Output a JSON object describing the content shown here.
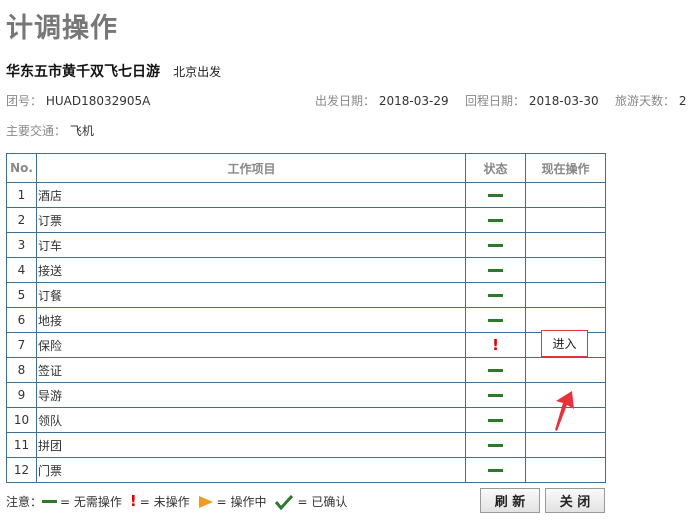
{
  "page": {
    "title": "计调操作"
  },
  "tour": {
    "name": "华东五市黄千双飞七日游",
    "departure_city": "北京出发"
  },
  "info": {
    "group_label": "团号：",
    "group_no": "HUAD18032905A",
    "depart_label": "出发日期：",
    "depart_date": "2018-03-29",
    "return_label": "回程日期：",
    "return_date": "2018-03-30",
    "days_label": "旅游天数：",
    "days": "2"
  },
  "transport": {
    "label": "主要交通：",
    "value": "飞机"
  },
  "table": {
    "headers": {
      "no": "No.",
      "item": "工作项目",
      "status": "状态",
      "op": "现在操作"
    },
    "rows": [
      {
        "no": "1",
        "item": "酒店",
        "status": "none"
      },
      {
        "no": "2",
        "item": "订票",
        "status": "none"
      },
      {
        "no": "3",
        "item": "订车",
        "status": "none"
      },
      {
        "no": "4",
        "item": "接送",
        "status": "none"
      },
      {
        "no": "5",
        "item": "订餐",
        "status": "none"
      },
      {
        "no": "6",
        "item": "地接",
        "status": "none"
      },
      {
        "no": "7",
        "item": "保险",
        "status": "pending"
      },
      {
        "no": "8",
        "item": "签证",
        "status": "none"
      },
      {
        "no": "9",
        "item": "导游",
        "status": "none"
      },
      {
        "no": "10",
        "item": "领队",
        "status": "none"
      },
      {
        "no": "11",
        "item": "拼团",
        "status": "none"
      },
      {
        "no": "12",
        "item": "门票",
        "status": "none"
      }
    ],
    "action_label": "进入"
  },
  "legend": {
    "note": "注意：",
    "none": "= 无需操作",
    "pending": "= 未操作",
    "in_progress": "= 操作中",
    "confirmed": "= 已确认"
  },
  "buttons": {
    "refresh": "刷 新",
    "close": "关 闭"
  },
  "colors": {
    "done_green": "#2d7a2d",
    "pending_red": "#e00000",
    "in_progress_orange": "#f39a1e",
    "table_border": "#3e6e93",
    "annotation_red": "#e0363a"
  },
  "icons": {
    "none": "green-dash-icon",
    "pending": "red-exclamation-icon",
    "in_progress": "orange-play-icon",
    "confirmed": "green-check-icon"
  }
}
